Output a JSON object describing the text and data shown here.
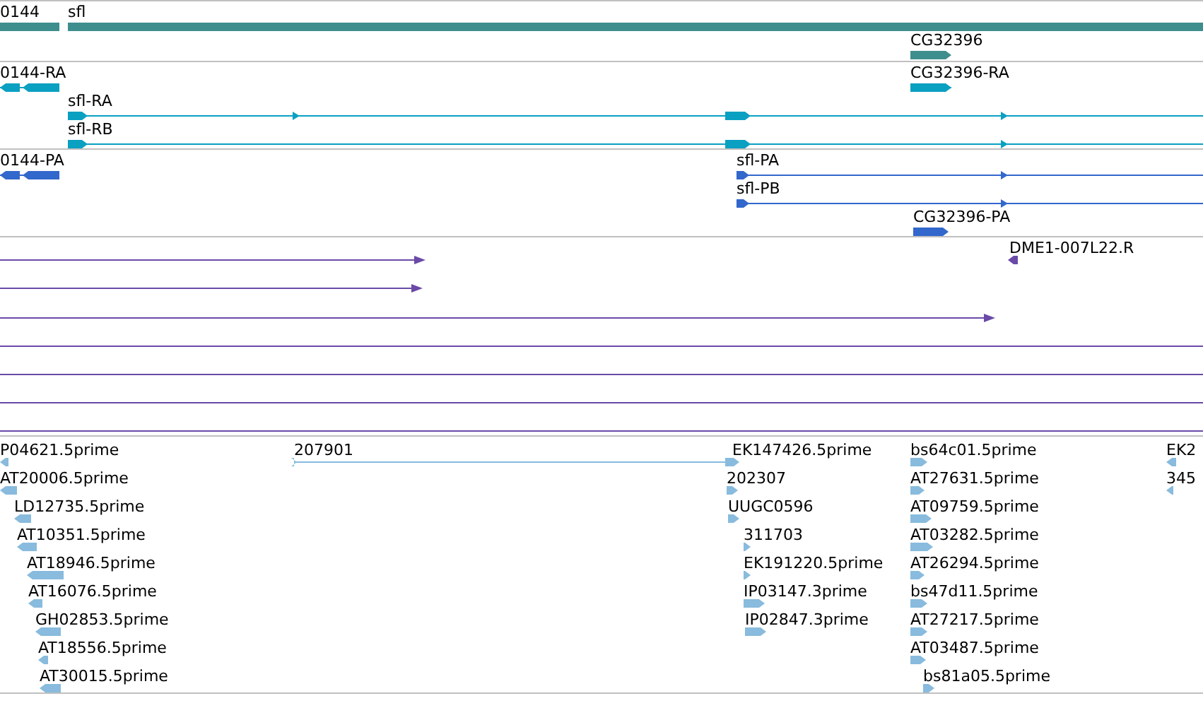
{
  "tracks": [
    {
      "kind": "gene",
      "features": [
        {
          "label": "0144",
          "reverse": true
        },
        {
          "label": "sfl",
          "reverse": false
        },
        {
          "label": "CG32396",
          "reverse": false
        }
      ]
    },
    {
      "kind": "mrna",
      "features": [
        {
          "label": "0144-RA",
          "reverse": true
        },
        {
          "label": "sfl-RA",
          "reverse": false
        },
        {
          "label": "sfl-RB",
          "reverse": false
        },
        {
          "label": "CG32396-RA",
          "reverse": false
        }
      ]
    },
    {
      "kind": "protein",
      "features": [
        {
          "label": "0144-PA",
          "reverse": true
        },
        {
          "label": "sfl-PA",
          "reverse": false
        },
        {
          "label": "sfl-PB",
          "reverse": false
        },
        {
          "label": "CG32396-PA",
          "reverse": false
        }
      ]
    },
    {
      "kind": "alignment",
      "features": [
        {
          "label": "DME1-007L22.R",
          "reverse": true
        }
      ]
    },
    {
      "kind": "est",
      "features": [
        {
          "label": "P04621.5prime",
          "reverse": true
        },
        {
          "label": "AT20006.5prime",
          "reverse": true
        },
        {
          "label": "LD12735.5prime",
          "reverse": true
        },
        {
          "label": "AT10351.5prime",
          "reverse": true
        },
        {
          "label": "AT18946.5prime",
          "reverse": true
        },
        {
          "label": "AT16076.5prime",
          "reverse": true
        },
        {
          "label": "GH02853.5prime",
          "reverse": true
        },
        {
          "label": "AT18556.5prime",
          "reverse": true
        },
        {
          "label": "AT30015.5prime",
          "reverse": true
        },
        {
          "label": "207901",
          "reverse": false
        },
        {
          "label": "EK147426.5prime",
          "reverse": false
        },
        {
          "label": "202307",
          "reverse": false
        },
        {
          "label": "UUGC0596",
          "reverse": false
        },
        {
          "label": "311703",
          "reverse": false
        },
        {
          "label": "EK191220.5prime",
          "reverse": false
        },
        {
          "label": "IP03147.3prime",
          "reverse": false
        },
        {
          "label": "IP02847.3prime",
          "reverse": false
        },
        {
          "label": "bs64c01.5prime",
          "reverse": false
        },
        {
          "label": "AT27631.5prime",
          "reverse": false
        },
        {
          "label": "AT09759.5prime",
          "reverse": false
        },
        {
          "label": "AT03282.5prime",
          "reverse": false
        },
        {
          "label": "AT26294.5prime",
          "reverse": false
        },
        {
          "label": "bs47d11.5prime",
          "reverse": false
        },
        {
          "label": "AT27217.5prime",
          "reverse": false
        },
        {
          "label": "AT03487.5prime",
          "reverse": false
        },
        {
          "label": "bs81a05.5prime",
          "reverse": false
        },
        {
          "label": "EK2",
          "reverse": true
        },
        {
          "label": "345",
          "reverse": true
        }
      ]
    }
  ]
}
